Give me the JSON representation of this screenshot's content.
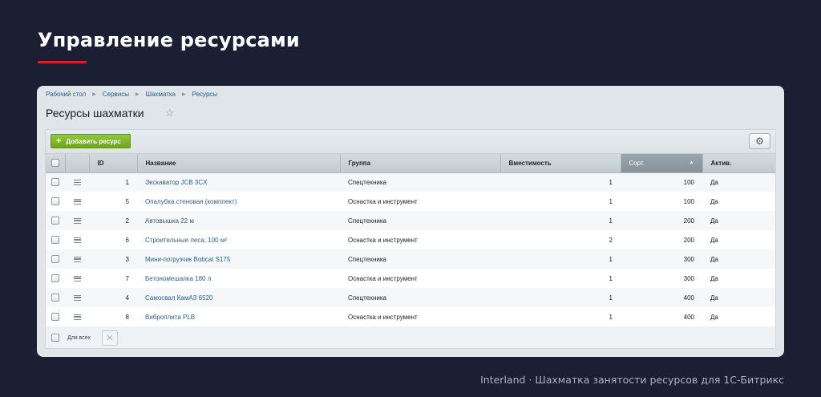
{
  "slide": {
    "title": "Управление ресурсами",
    "caption": "Interland · Шахматка занятости ресурсов для 1С-Битрикс"
  },
  "colors": {
    "background": "#1b1f33",
    "accent": "#d1222b",
    "add_button": "#7ab42a",
    "link": "#2c5f8d"
  },
  "breadcrumb": [
    "Рабочий стол",
    "Сервисы",
    "Шахматка",
    "Ресурсы"
  ],
  "page": {
    "title": "Ресурсы шахматки",
    "favorite_icon": "star-icon"
  },
  "toolbar": {
    "add_label": "Добавить ресурс",
    "add_icon": "plus-icon",
    "settings_icon": "gear-icon"
  },
  "table": {
    "columns": {
      "id": "ID",
      "name": "Название",
      "group": "Группа",
      "capacity": "Вместимость",
      "sort": "Сорт.",
      "active": "Актив."
    },
    "sorted_by": "sort",
    "sort_direction": "ascending",
    "rows": [
      {
        "id": "1",
        "name": "Экскаватор JCB 3CX",
        "group": "Спецтехника",
        "capacity": "1",
        "sort": "100",
        "active": "Да"
      },
      {
        "id": "5",
        "name": "Опалубка стеновая (комплект)",
        "group": "Оснастка и инструмент",
        "capacity": "1",
        "sort": "100",
        "active": "Да"
      },
      {
        "id": "2",
        "name": "Автовышка 22 м",
        "group": "Спецтехника",
        "capacity": "1",
        "sort": "200",
        "active": "Да"
      },
      {
        "id": "6",
        "name": "Строительные леса, 100 м²",
        "group": "Оснастка и инструмент",
        "capacity": "2",
        "sort": "200",
        "active": "Да"
      },
      {
        "id": "3",
        "name": "Мини-погрузчик Bobcat S175",
        "group": "Спецтехника",
        "capacity": "1",
        "sort": "300",
        "active": "Да"
      },
      {
        "id": "7",
        "name": "Бетономешалка 180 л",
        "group": "Оснастка и инструмент",
        "capacity": "1",
        "sort": "300",
        "active": "Да"
      },
      {
        "id": "4",
        "name": "Самосвал КамАЗ 6520",
        "group": "Спецтехника",
        "capacity": "1",
        "sort": "400",
        "active": "Да"
      },
      {
        "id": "8",
        "name": "Виброплита PLB",
        "group": "Оснастка и инструмент",
        "capacity": "1",
        "sort": "400",
        "active": "Да"
      }
    ]
  },
  "footer": {
    "for_all_label": "Для всех",
    "delete_icon": "close-icon"
  }
}
